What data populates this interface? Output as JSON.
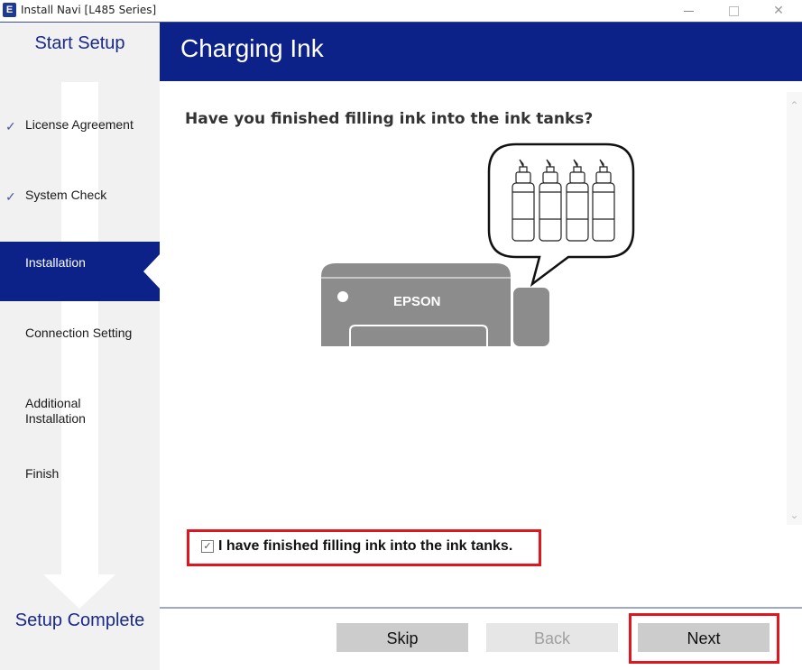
{
  "window": {
    "title": "Install Navi [L485 Series]",
    "app_icon_glyph": "E",
    "controls": [
      "minimize",
      "maximize",
      "close"
    ]
  },
  "sidebar": {
    "start_label": "Start Setup",
    "end_label": "Setup Complete",
    "steps": [
      {
        "label": "License Agreement",
        "status": "done"
      },
      {
        "label": "System Check",
        "status": "done"
      },
      {
        "label": "Installation",
        "status": "active"
      },
      {
        "label": "Connection Setting",
        "status": "pending"
      },
      {
        "label": "Additional Installation",
        "line1": "Additional",
        "line2": "Installation",
        "status": "pending"
      },
      {
        "label": "Finish",
        "status": "pending"
      }
    ],
    "check_glyph": "✓"
  },
  "header": {
    "title": "Charging Ink"
  },
  "content": {
    "question": "Have you finished filling ink into the ink tanks?",
    "illustration": {
      "printer_brand": "EPSON",
      "bottle_count": 4
    },
    "confirm_checkbox": {
      "label": "I have finished filling ink into the ink tanks.",
      "checked": true,
      "glyph": "✓"
    }
  },
  "scrollbar": {
    "up_glyph": "⌃",
    "down_glyph": "⌄"
  },
  "footer": {
    "skip_label": "Skip",
    "back_label": "Back",
    "back_enabled": false,
    "next_label": "Next"
  },
  "colors": {
    "brand_blue": "#0c2289",
    "highlight_red": "#e0161f",
    "sidebar_bg": "#f1f1f1",
    "printer_gray": "#8c8c8c"
  }
}
